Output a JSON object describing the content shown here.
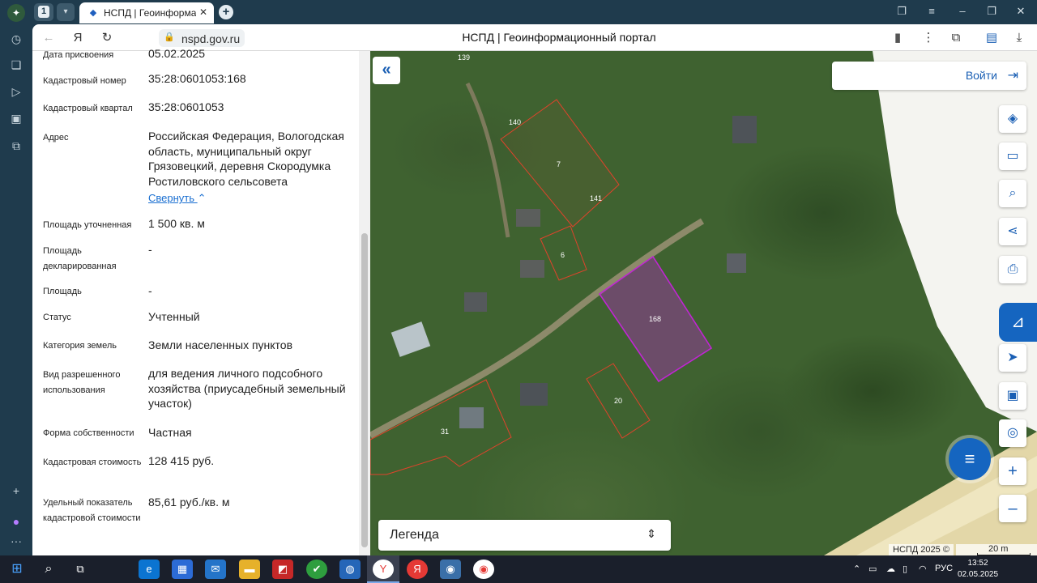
{
  "browser": {
    "tab_count": "1",
    "tab_title": "НСПД | Геоинформационный портал",
    "url": "nspd.gov.ru",
    "page_title": "НСПД | Геоинформационный портал"
  },
  "panel": {
    "properties": [
      {
        "label": "Дата присвоения",
        "value": "05.02.2025"
      },
      {
        "label": "Кадастровый номер",
        "value": "35:28:0601053:168"
      },
      {
        "label": "Кадастровый квартал",
        "value": "35:28:0601053"
      },
      {
        "label": "Адрес",
        "value": "Российская Федерация, Вологодская область, муниципальный округ Грязовецкий, деревня Скородумка Ростиловского сельсовета"
      },
      {
        "label": "Площадь уточненная",
        "value": "1 500 кв. м"
      },
      {
        "label": "Площадь декларированная",
        "value": "-"
      },
      {
        "label": "Площадь",
        "value": "-"
      },
      {
        "label": "Статус",
        "value": "Учтенный"
      },
      {
        "label": "Категория земель",
        "value": "Земли населенных пунктов"
      },
      {
        "label": "Вид разрешенного использования",
        "value": "для ведения личного подсобного хозяйства (приусадебный земельный участок)"
      },
      {
        "label": "Форма собственности",
        "value": "Частная"
      },
      {
        "label": "Кадастровая стоимость",
        "value": "128 415 руб."
      },
      {
        "label": "Удельный показатель кадастровой стоимости",
        "value": "85,61 руб./кв. м"
      }
    ],
    "collapse_label": "Свернуть"
  },
  "map": {
    "login_label": "Войти",
    "legend_label": "Легенда",
    "copyright": "НСПД 2025 ©",
    "scale_label": "20 m",
    "parcel_labels": [
      "139",
      "140",
      "7",
      "141",
      "6",
      "168",
      "20",
      "31"
    ],
    "colors": {
      "parcel_border": "#e0432b",
      "selected_parcel": "#c026d3",
      "accent": "#1565c0"
    }
  },
  "taskbar": {
    "language": "РУС",
    "time": "13:52",
    "date": "02.05.2025"
  }
}
